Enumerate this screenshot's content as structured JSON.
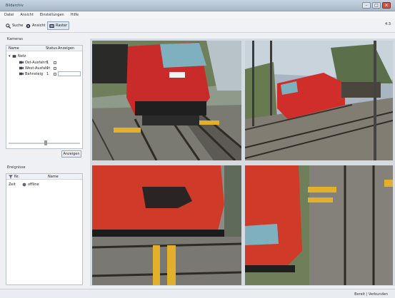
{
  "window": {
    "title": "Bildarchiv"
  },
  "menu": [
    "Datei",
    "Ansicht",
    "Einstellungen",
    "Hilfe"
  ],
  "toolbar": {
    "search_label": "Suche",
    "live_label": "Ansicht",
    "grid_label": "Raster",
    "right_label": "4:3"
  },
  "sidebar": {
    "section_top": "Kameras",
    "columns": [
      "Name",
      "Status",
      "Anzeigen"
    ],
    "tree_root": "Netz",
    "items": [
      {
        "label": "Ost-Ausfahrt",
        "status": "1"
      },
      {
        "label": "West-Ausfahrt",
        "status": "1"
      },
      {
        "label": "Bahnsteig",
        "status": "1"
      }
    ],
    "apply_label": "Anzeigen",
    "section_bottom": "Ereignisse",
    "event_columns": [
      "Nr.",
      "Name"
    ],
    "event_row": {
      "id": "Zeit",
      "label": "offline"
    }
  },
  "status": {
    "text": "Bereit | Verbunden"
  }
}
